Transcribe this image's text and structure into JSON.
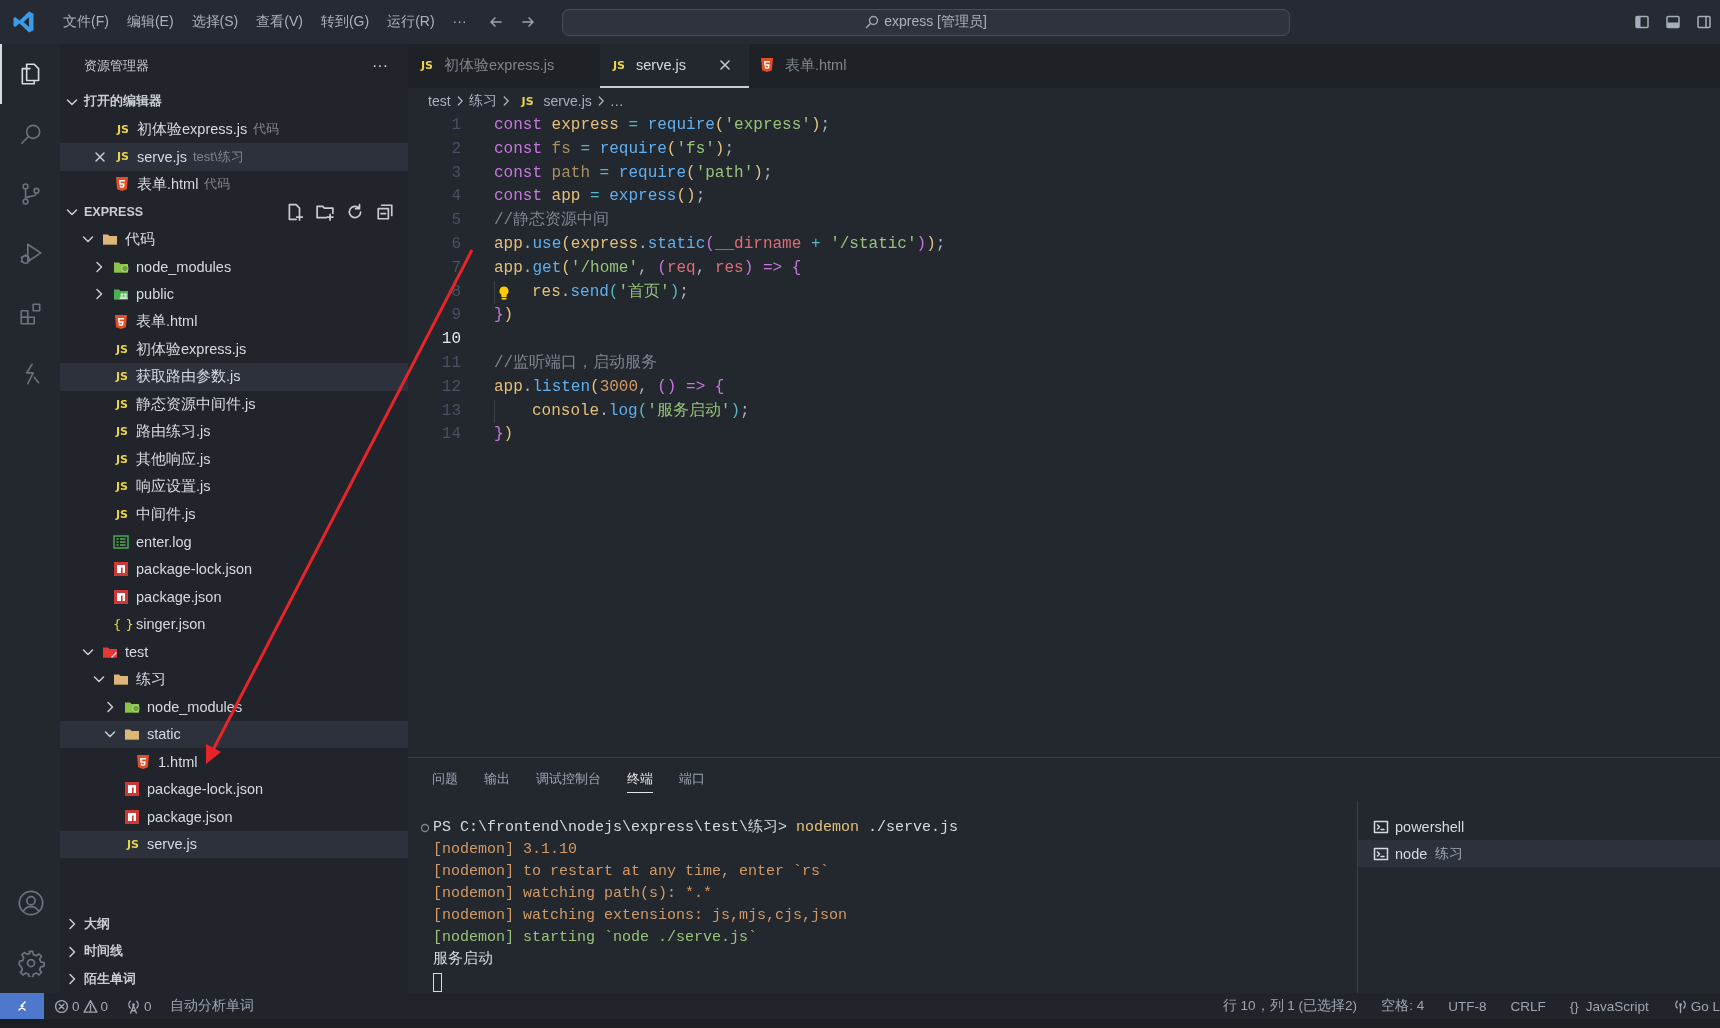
{
  "title_bar": {
    "menu": [
      "文件(F)",
      "编辑(E)",
      "选择(S)",
      "查看(V)",
      "转到(G)",
      "运行(R)"
    ],
    "more": "···",
    "search": {
      "value": "express [管理员]"
    }
  },
  "activity_bar": {
    "items": [
      {
        "kind": "explorer",
        "selected": true
      },
      {
        "kind": "search",
        "selected": false
      },
      {
        "kind": "source-control",
        "selected": false
      },
      {
        "kind": "run-debug",
        "selected": false
      },
      {
        "kind": "extensions",
        "selected": false
      },
      {
        "kind": "plugin",
        "selected": false
      }
    ],
    "bottom": [
      {
        "kind": "account"
      },
      {
        "kind": "settings"
      }
    ]
  },
  "sidebar": {
    "title": "资源管理器",
    "more": "···",
    "open_editors": {
      "title": "打开的编辑器",
      "expanded": true,
      "items": [
        {
          "name": "初体验express.js",
          "kind": "js",
          "badge": "JS",
          "description": "代码",
          "selected": false
        },
        {
          "name": "serve.js",
          "kind": "js",
          "badge": "JS",
          "description": "test\\练习",
          "selected": true
        },
        {
          "name": "表单.html",
          "kind": "html",
          "description": "代码",
          "selected": false
        }
      ]
    },
    "workspace": {
      "title": "EXPRESS",
      "expanded": true,
      "tree": [
        {
          "name": "代码",
          "kind": "folder",
          "expanded": true,
          "selected": false,
          "children": [
            {
              "name": "node_modules",
              "kind": "folder-node",
              "expanded": false,
              "selected": false
            },
            {
              "name": "public",
              "kind": "folder-public",
              "expanded": false,
              "selected": false
            },
            {
              "name": "表单.html",
              "kind": "html",
              "selected": false
            },
            {
              "name": "初体验express.js",
              "kind": "js",
              "badge": "JS",
              "selected": false
            },
            {
              "name": "获取路由参数.js",
              "kind": "js",
              "badge": "JS",
              "selected": true
            },
            {
              "name": "静态资源中间件.js",
              "kind": "js",
              "badge": "JS",
              "selected": false
            },
            {
              "name": "路由练习.js",
              "kind": "js",
              "badge": "JS",
              "selected": false
            },
            {
              "name": "其他响应.js",
              "kind": "js",
              "badge": "JS",
              "selected": false
            },
            {
              "name": "响应设置.js",
              "kind": "js",
              "badge": "JS",
              "selected": false
            },
            {
              "name": "中间件.js",
              "kind": "js",
              "badge": "JS",
              "selected": false
            },
            {
              "name": "enter.log",
              "kind": "log",
              "selected": false
            },
            {
              "name": "package-lock.json",
              "kind": "npm",
              "selected": false
            },
            {
              "name": "package.json",
              "kind": "npm",
              "selected": false
            },
            {
              "name": "singer.json",
              "kind": "json",
              "badge": "{ }",
              "selected": false
            }
          ]
        },
        {
          "name": "test",
          "kind": "folder-test",
          "expanded": true,
          "selected": false,
          "children": [
            {
              "name": "练习",
              "kind": "folder",
              "expanded": true,
              "selected": false,
              "children": [
                {
                  "name": "node_modules",
                  "kind": "folder-node",
                  "expanded": false,
                  "selected": false
                },
                {
                  "name": "static",
                  "kind": "folder",
                  "expanded": true,
                  "selected": true,
                  "children": [
                    {
                      "name": "1.html",
                      "kind": "html",
                      "selected": false
                    }
                  ]
                },
                {
                  "name": "package-lock.json",
                  "kind": "npm",
                  "selected": false
                },
                {
                  "name": "package.json",
                  "kind": "npm",
                  "selected": false
                },
                {
                  "name": "serve.js",
                  "kind": "js",
                  "badge": "JS",
                  "selected": true
                }
              ]
            }
          ]
        }
      ]
    },
    "sections": [
      {
        "title": "大纲",
        "expanded": false
      },
      {
        "title": "时间线",
        "expanded": false
      },
      {
        "title": "陌生单词",
        "expanded": false
      }
    ]
  },
  "editor": {
    "tabs": [
      {
        "label": "初体验express.js",
        "kind": "js",
        "badge": "JS",
        "selected": false
      },
      {
        "label": "serve.js",
        "kind": "js",
        "badge": "JS",
        "selected": true
      },
      {
        "label": "表单.html",
        "kind": "html",
        "selected": false
      }
    ],
    "breadcrumbs": [
      {
        "text": "test"
      },
      {
        "text": "练习"
      },
      {
        "text": "serve.js",
        "badge": "JS"
      },
      {
        "text": "…"
      }
    ],
    "lines": [
      {
        "number": "1",
        "current": false,
        "tokens": [
          {
            "kind": "keyword",
            "text": "const "
          },
          {
            "kind": "variable",
            "text": "express"
          },
          {
            "kind": "operator",
            "text": " = "
          },
          {
            "kind": "function",
            "text": "require"
          },
          {
            "kind": "bracket1",
            "text": "("
          },
          {
            "kind": "string",
            "text": "'express'"
          },
          {
            "kind": "bracket1",
            "text": ")"
          },
          {
            "kind": "punctuation",
            "text": ";"
          }
        ]
      },
      {
        "number": "2",
        "current": false,
        "tokens": [
          {
            "kind": "keyword",
            "text": "const "
          },
          {
            "kind": "unused",
            "text": "fs"
          },
          {
            "kind": "operator",
            "text": " = "
          },
          {
            "kind": "function",
            "text": "require"
          },
          {
            "kind": "bracket1",
            "text": "("
          },
          {
            "kind": "string",
            "text": "'fs'"
          },
          {
            "kind": "bracket1",
            "text": ")"
          },
          {
            "kind": "punctuation",
            "text": ";"
          }
        ]
      },
      {
        "number": "3",
        "current": false,
        "tokens": [
          {
            "kind": "keyword",
            "text": "const "
          },
          {
            "kind": "unused",
            "text": "path"
          },
          {
            "kind": "operator",
            "text": " = "
          },
          {
            "kind": "function",
            "text": "require"
          },
          {
            "kind": "bracket1",
            "text": "("
          },
          {
            "kind": "string",
            "text": "'path'"
          },
          {
            "kind": "bracket1",
            "text": ")"
          },
          {
            "kind": "punctuation",
            "text": ";"
          }
        ]
      },
      {
        "number": "4",
        "current": false,
        "tokens": [
          {
            "kind": "keyword",
            "text": "const "
          },
          {
            "kind": "variable",
            "text": "app"
          },
          {
            "kind": "operator",
            "text": " = "
          },
          {
            "kind": "function",
            "text": "express"
          },
          {
            "kind": "bracket1",
            "text": "()"
          },
          {
            "kind": "punctuation",
            "text": ";"
          }
        ]
      },
      {
        "number": "5",
        "current": false,
        "tokens": [
          {
            "kind": "comment",
            "text": "//静态资源中间"
          }
        ]
      },
      {
        "number": "6",
        "current": false,
        "tokens": [
          {
            "kind": "variable",
            "text": "app"
          },
          {
            "kind": "punctuation",
            "text": "."
          },
          {
            "kind": "function",
            "text": "use"
          },
          {
            "kind": "bracket1",
            "text": "("
          },
          {
            "kind": "variable",
            "text": "express"
          },
          {
            "kind": "punctuation",
            "text": "."
          },
          {
            "kind": "function",
            "text": "static"
          },
          {
            "kind": "bracket2",
            "text": "("
          },
          {
            "kind": "parameter",
            "text": "__dirname"
          },
          {
            "kind": "operator",
            "text": " + "
          },
          {
            "kind": "string",
            "text": "'/static'"
          },
          {
            "kind": "bracket2",
            "text": ")"
          },
          {
            "kind": "bracket1",
            "text": ")"
          },
          {
            "kind": "punctuation",
            "text": ";"
          }
        ]
      },
      {
        "number": "7",
        "current": false,
        "tokens": [
          {
            "kind": "variable",
            "text": "app"
          },
          {
            "kind": "punctuation",
            "text": "."
          },
          {
            "kind": "function",
            "text": "get"
          },
          {
            "kind": "bracket1",
            "text": "("
          },
          {
            "kind": "string",
            "text": "'/home'"
          },
          {
            "kind": "punctuation",
            "text": ", "
          },
          {
            "kind": "bracket2",
            "text": "("
          },
          {
            "kind": "parameter",
            "text": "req"
          },
          {
            "kind": "punctuation",
            "text": ", "
          },
          {
            "kind": "parameter",
            "text": "res"
          },
          {
            "kind": "bracket2",
            "text": ")"
          },
          {
            "kind": "keyword",
            "text": " => "
          },
          {
            "kind": "bracket2",
            "text": "{"
          }
        ]
      },
      {
        "number": "8",
        "current": false,
        "indent": true,
        "lightbulb": true,
        "tokens": [
          {
            "kind": "variable",
            "text": "res"
          },
          {
            "kind": "punctuation",
            "text": "."
          },
          {
            "kind": "function",
            "text": "send"
          },
          {
            "kind": "bracket3",
            "text": "("
          },
          {
            "kind": "string",
            "text": "'首页'"
          },
          {
            "kind": "bracket3",
            "text": ")"
          },
          {
            "kind": "punctuation",
            "text": ";"
          }
        ]
      },
      {
        "number": "9",
        "current": false,
        "tokens": [
          {
            "kind": "bracket2",
            "text": "}"
          },
          {
            "kind": "bracket1",
            "text": ")"
          }
        ]
      },
      {
        "number": "10",
        "current": true
      },
      {
        "number": "11",
        "current": false,
        "tokens": [
          {
            "kind": "comment",
            "text": "//监听端口，启动服务"
          }
        ]
      },
      {
        "number": "12",
        "current": false,
        "tokens": [
          {
            "kind": "variable",
            "text": "app"
          },
          {
            "kind": "punctuation",
            "text": "."
          },
          {
            "kind": "function",
            "text": "listen"
          },
          {
            "kind": "bracket1",
            "text": "("
          },
          {
            "kind": "number",
            "text": "3000"
          },
          {
            "kind": "punctuation",
            "text": ", "
          },
          {
            "kind": "bracket2",
            "text": "()"
          },
          {
            "kind": "keyword",
            "text": " => "
          },
          {
            "kind": "bracket2",
            "text": "{"
          }
        ]
      },
      {
        "number": "13",
        "current": false,
        "indent": true,
        "tokens": [
          {
            "kind": "variable",
            "text": "console"
          },
          {
            "kind": "punctuation",
            "text": "."
          },
          {
            "kind": "function",
            "text": "log"
          },
          {
            "kind": "bracket3",
            "text": "("
          },
          {
            "kind": "string",
            "text": "'服务启动'"
          },
          {
            "kind": "bracket3",
            "text": ")"
          },
          {
            "kind": "punctuation",
            "text": ";"
          }
        ]
      },
      {
        "number": "14",
        "current": false,
        "tokens": [
          {
            "kind": "bracket2",
            "text": "}"
          },
          {
            "kind": "bracket1",
            "text": ")"
          }
        ]
      }
    ]
  },
  "panel": {
    "tabs": [
      {
        "label": "问题",
        "selected": false
      },
      {
        "label": "输出",
        "selected": false
      },
      {
        "label": "调试控制台",
        "selected": false
      },
      {
        "label": "终端",
        "selected": true
      },
      {
        "label": "端口",
        "selected": false
      }
    ],
    "terminal": {
      "cursor": true,
      "lines": [
        {
          "kind": "command",
          "segments": [
            {
              "kind": "plain",
              "text": "PS C:\\frontend\\nodejs\\express\\test\\练习> "
            },
            {
              "kind": "command",
              "text": "nodemon"
            },
            {
              "kind": "plain",
              "text": " ./serve.js"
            }
          ]
        },
        {
          "kind": "output",
          "segments": [
            {
              "kind": "nodemon",
              "text": "[nodemon] 3.1.10"
            }
          ]
        },
        {
          "kind": "output",
          "segments": [
            {
              "kind": "nodemon",
              "text": "[nodemon] to restart at any time, enter `rs`"
            }
          ]
        },
        {
          "kind": "output",
          "segments": [
            {
              "kind": "nodemon",
              "text": "[nodemon] watching path(s): *.*"
            }
          ]
        },
        {
          "kind": "output",
          "segments": [
            {
              "kind": "nodemon",
              "text": "[nodemon] watching extensions: js,mjs,cjs,json"
            }
          ]
        },
        {
          "kind": "output",
          "segments": [
            {
              "kind": "success",
              "text": "[nodemon] starting `node ./serve.js`"
            }
          ]
        },
        {
          "kind": "output",
          "segments": [
            {
              "kind": "plain",
              "text": "服务启动"
            }
          ]
        }
      ]
    },
    "terminals": [
      {
        "name": "powershell",
        "selected": false
      },
      {
        "name": "node",
        "description": "练习",
        "selected": true
      }
    ]
  },
  "status_bar": {
    "left": [
      {
        "kind": "remote"
      },
      {
        "kind": "problems",
        "errors": "0",
        "warnings": "0"
      },
      {
        "kind": "ports",
        "text": "0"
      },
      {
        "kind": "text",
        "text": "自动分析单词"
      }
    ],
    "right": [
      {
        "kind": "text",
        "text": "行 10，列 1 (已选择2)"
      },
      {
        "kind": "text",
        "text": "空格: 4"
      },
      {
        "kind": "text",
        "text": "UTF-8"
      },
      {
        "kind": "text",
        "text": "CRLF"
      },
      {
        "kind": "language",
        "glyph": "{}",
        "text": "JavaScript"
      },
      {
        "kind": "live",
        "text": "Go L"
      }
    ]
  }
}
